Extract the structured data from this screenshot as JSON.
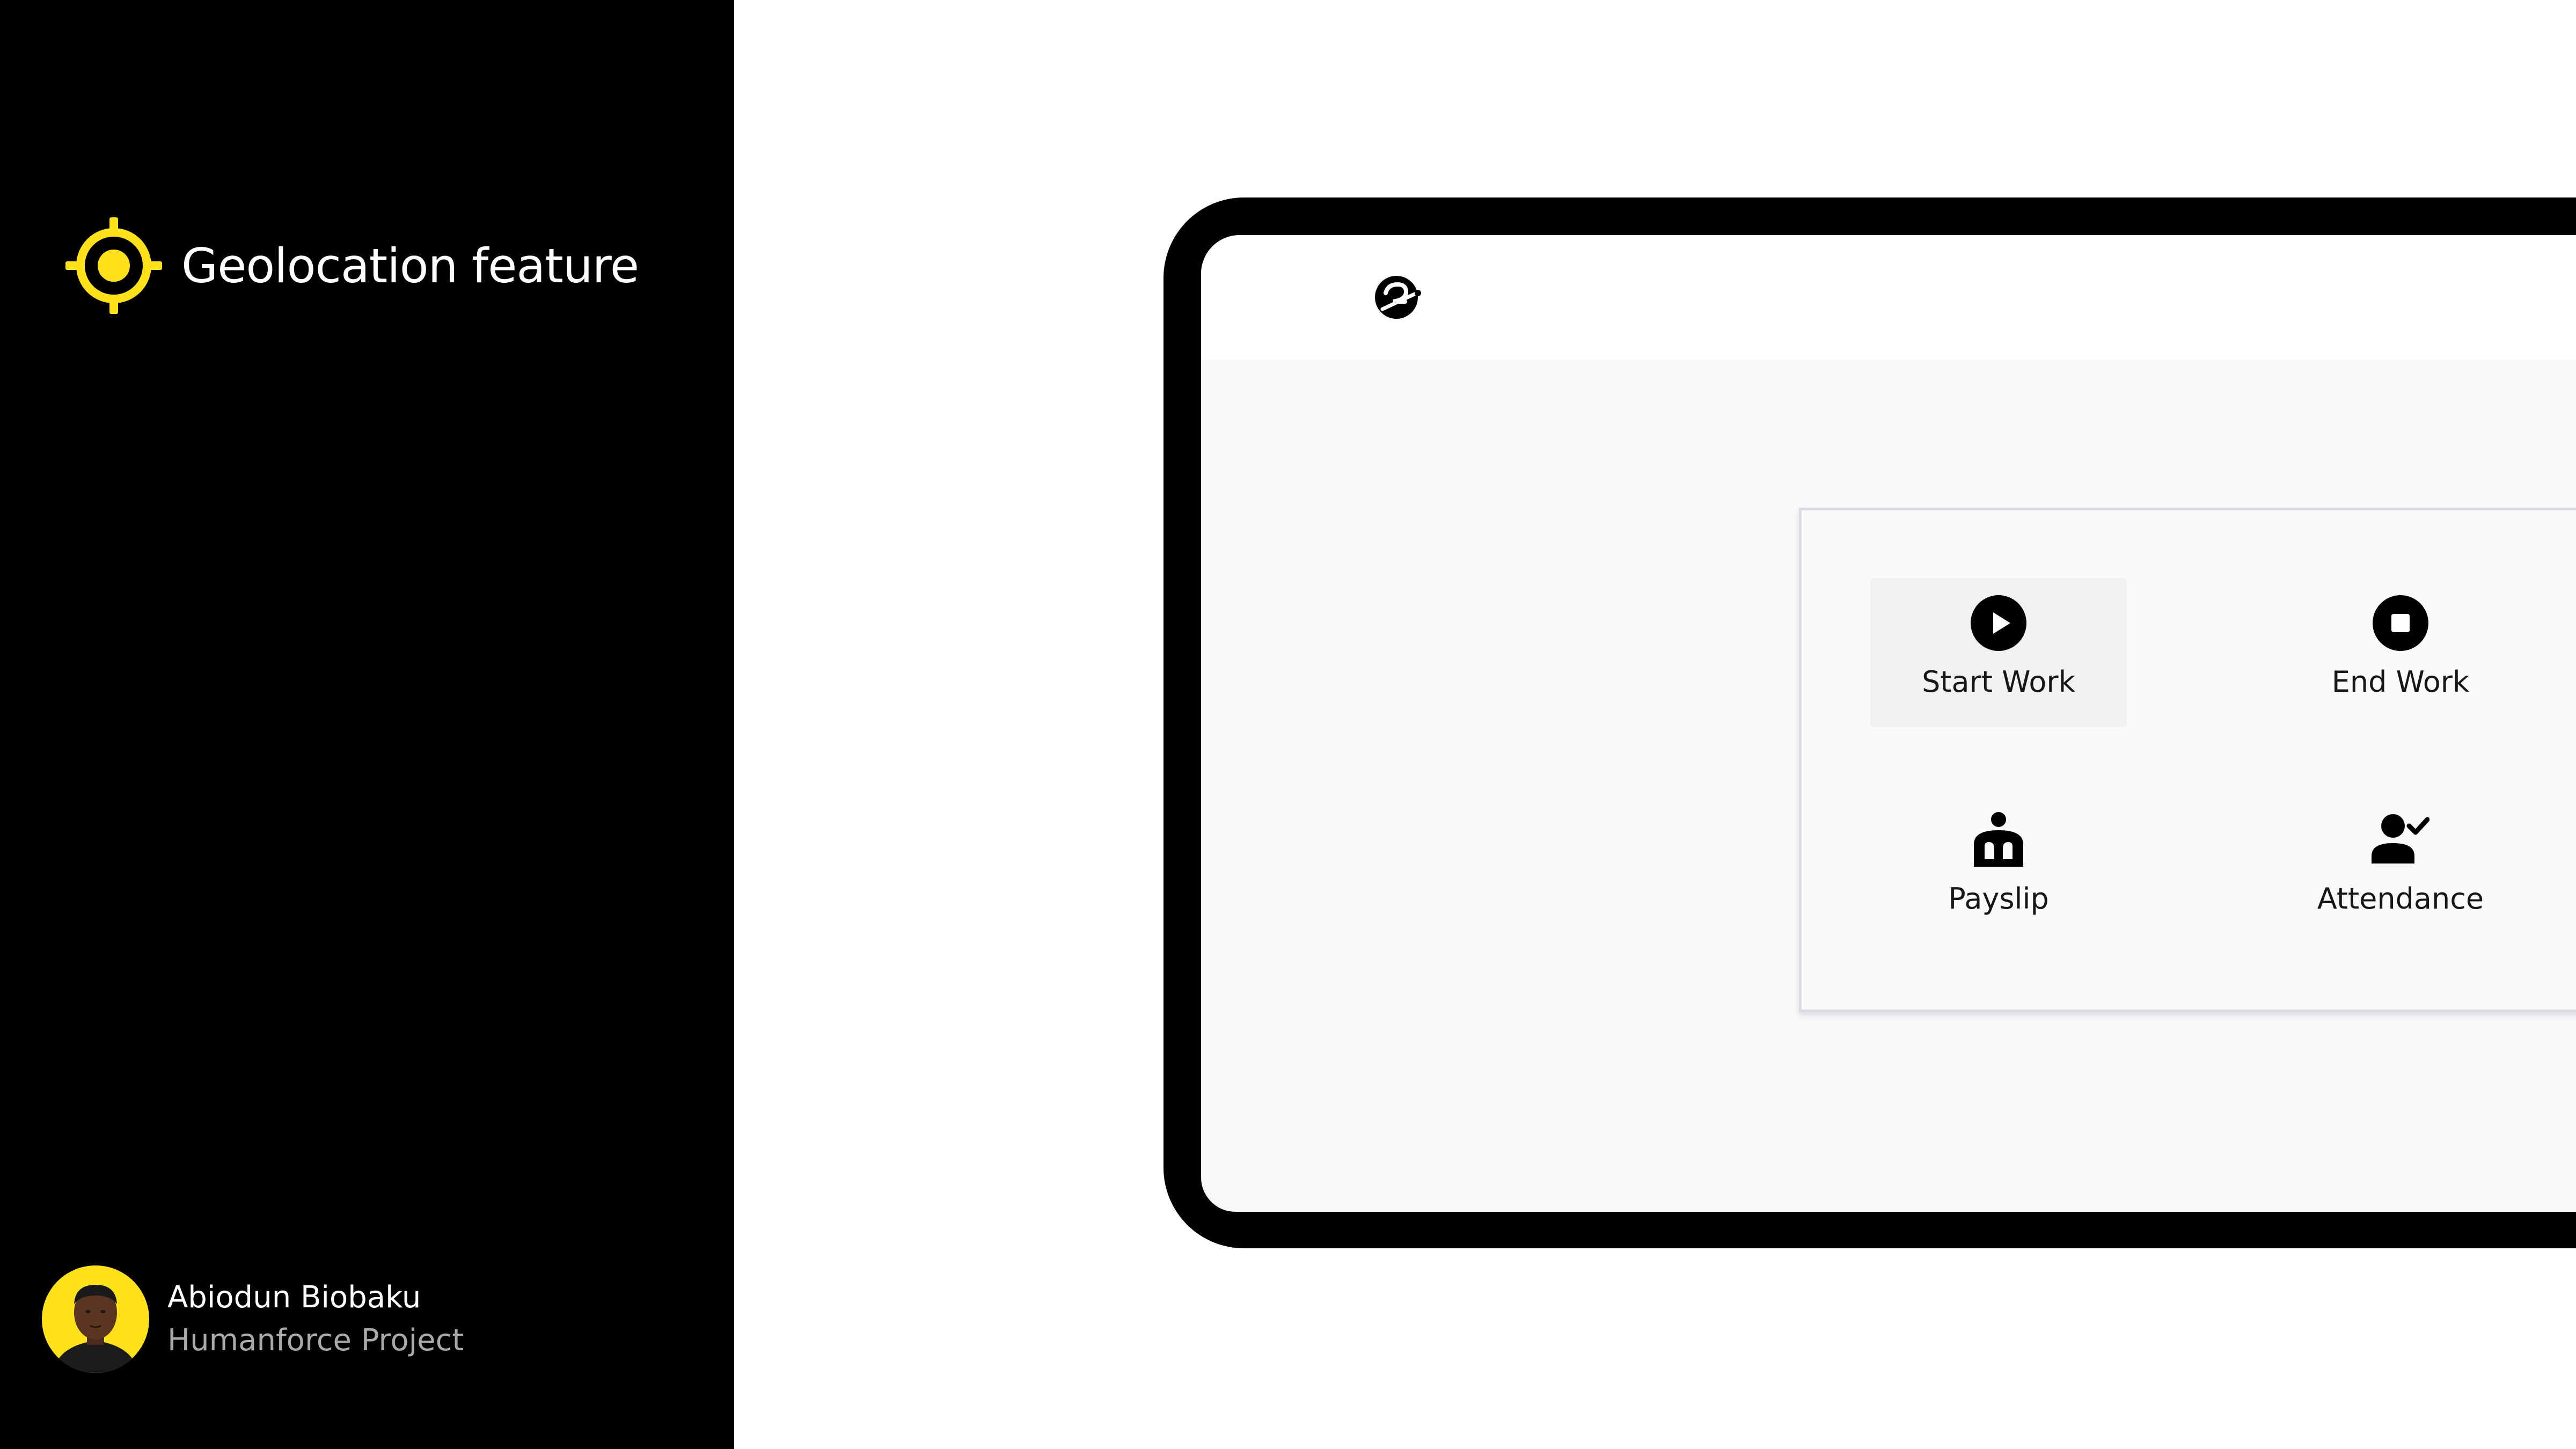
{
  "feature": {
    "title": "Geolocation feature",
    "icon": "location-target-icon",
    "accent_color": "#FFE21A"
  },
  "author": {
    "name": "Abiodun Biobaku",
    "project": "Humanforce Project",
    "avatar_background": "#FFE21A"
  },
  "app": {
    "logo_icon": "app-logo-icon",
    "menu": [
      {
        "label": "Start Work",
        "icon": "play-circle-icon",
        "active": true
      },
      {
        "label": "End Work",
        "icon": "stop-circle-icon",
        "active": false
      },
      {
        "label": "Payslip",
        "icon": "payslip-person-icon",
        "active": false
      },
      {
        "label": "Attendance",
        "icon": "person-check-icon",
        "active": false
      }
    ]
  }
}
